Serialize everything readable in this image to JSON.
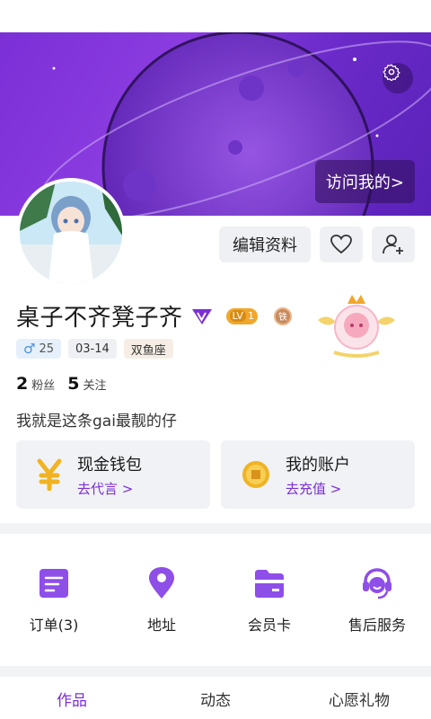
{
  "header": {
    "visit_label": "访问我的>"
  },
  "profile": {
    "username": "桌子不齐凳子齐",
    "level_prefix": "LV",
    "level": "1",
    "rank": "铁",
    "gender_symbol": "♂",
    "age": "25",
    "birthday": "03-14",
    "zodiac": "双鱼座",
    "fans_count": "2",
    "fans_label": "粉丝",
    "following_count": "5",
    "following_label": "关注",
    "bio": "我就是这条gai最靓的仔"
  },
  "actions": {
    "edit_label": "编辑资料"
  },
  "wallet": {
    "cash_title": "现金钱包",
    "cash_link": "去代言 >",
    "account_title": "我的账户",
    "account_link": "去充值 >"
  },
  "menu": [
    {
      "label": "订单(3)",
      "icon": "order-icon"
    },
    {
      "label": "地址",
      "icon": "location-pin-icon"
    },
    {
      "label": "会员卡",
      "icon": "member-card-icon"
    },
    {
      "label": "售后服务",
      "icon": "headset-icon"
    }
  ],
  "tabs": [
    {
      "label": "作品",
      "active": true
    },
    {
      "label": "动态",
      "active": false
    },
    {
      "label": "心愿礼物",
      "active": false
    }
  ],
  "colors": {
    "accent": "#7b2fd6",
    "banner": "#8a3ce0",
    "card_bg": "#f0f2f5"
  }
}
